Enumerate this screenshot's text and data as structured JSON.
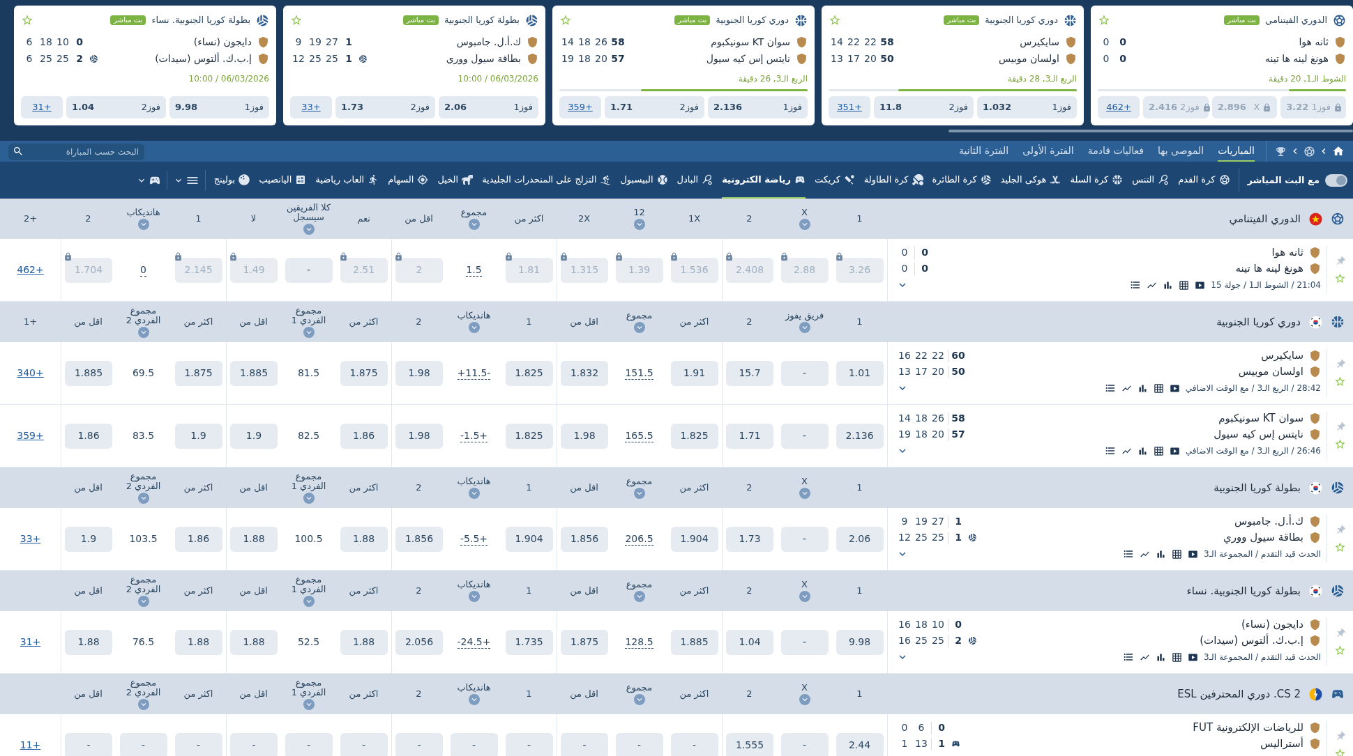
{
  "carousel": {
    "cards": [
      {
        "league": "الدوري الفيتنامي",
        "kind": "football",
        "live": "بث مباشر",
        "teams": [
          {
            "name": "ثانه هوا",
            "score": "0",
            "sets": [
              "0"
            ],
            "serving": false
          },
          {
            "name": "هونغ لينه ها تينه",
            "score": "0",
            "sets": [
              "0"
            ],
            "serving": false
          }
        ],
        "status": "الشوط الـ1, 20 دقيقة",
        "progress": {
          "level": 0.23
        },
        "odds": [
          {
            "label": "فوز1",
            "value": "3.22",
            "locked": true
          },
          {
            "label": "X",
            "value": "2.896",
            "locked": true
          },
          {
            "label": "فوز2",
            "value": "2.416",
            "locked": true
          }
        ],
        "more": "462+"
      },
      {
        "league": "دوري كوريا الجنوبية",
        "kind": "basketball",
        "live": "بث مباشر",
        "teams": [
          {
            "name": "سايكيرس",
            "score": "58",
            "sets": [
              "22",
              "22",
              "14"
            ],
            "serving": false
          },
          {
            "name": "اولسان موبيس",
            "score": "50",
            "sets": [
              "20",
              "17",
              "13"
            ],
            "serving": false
          }
        ],
        "status": "الربع الـ3, 28 دقيقة",
        "progress": {
          "level": 0.72
        },
        "odds": [
          {
            "label": "فوز1",
            "value": "1.032",
            "locked": false
          },
          {
            "label": "فوز2",
            "value": "11.8",
            "locked": false
          }
        ],
        "more": "351+"
      },
      {
        "league": "دوري كوريا الجنوبية",
        "kind": "basketball",
        "live": "بث مباشر",
        "teams": [
          {
            "name": "سوان KT سونيكبوم",
            "score": "58",
            "sets": [
              "26",
              "18",
              "14"
            ],
            "serving": false
          },
          {
            "name": "نايتس إس كيه سيول",
            "score": "57",
            "sets": [
              "20",
              "18",
              "19"
            ],
            "serving": false
          }
        ],
        "status": "الربع الـ3, 26 دقيقة",
        "progress": {
          "level": 0.67
        },
        "odds": [
          {
            "label": "فوز1",
            "value": "2.136",
            "locked": false
          },
          {
            "label": "فوز2",
            "value": "1.71",
            "locked": false
          }
        ],
        "more": "359+"
      },
      {
        "league": "بطولة كوريا الجنوبية",
        "kind": "volleyball",
        "live": "بث مباشر",
        "teams": [
          {
            "name": "ك.أ.ل. جامبوس",
            "score": "1",
            "sets": [
              "27",
              "19",
              "9"
            ],
            "serving": false
          },
          {
            "name": "بطاقة سيول ووري",
            "score": "1",
            "sets": [
              "25",
              "25",
              "12"
            ],
            "serving": true
          }
        ],
        "status": "10:00 / 06/03/2026",
        "odds": [
          {
            "label": "فوز1",
            "value": "2.06",
            "locked": false
          },
          {
            "label": "فوز2",
            "value": "1.73",
            "locked": false
          }
        ],
        "more": "33+"
      },
      {
        "league": "بطولة كوريا الجنوبية. نساء",
        "kind": "volleyball",
        "live": "بث مباشر",
        "teams": [
          {
            "name": "دايجون (نساء)",
            "score": "0",
            "sets": [
              "10",
              "18",
              "6"
            ],
            "serving": false
          },
          {
            "name": "إ.ب.ك. ألتوس (سيدات)",
            "score": "2",
            "sets": [
              "25",
              "25",
              "6"
            ],
            "serving": true
          }
        ],
        "status": "10:00 / 06/03/2026",
        "odds": [
          {
            "label": "فوز1",
            "value": "9.98",
            "locked": false
          },
          {
            "label": "فوز2",
            "value": "1.04",
            "locked": false
          }
        ],
        "more": "31+"
      }
    ]
  },
  "nav": {
    "tabs": [
      {
        "label": "المباريات",
        "selected": true
      },
      {
        "label": "الموصى بها",
        "selected": false
      },
      {
        "label": "فعاليات قادمة",
        "selected": false
      },
      {
        "label": "الفترة الأولى",
        "selected": false
      },
      {
        "label": "الفترة الثانية",
        "selected": false
      }
    ],
    "search": {
      "placeholder": "البحث حسب المباراة"
    }
  },
  "sports_bar": {
    "live_toggle": {
      "label": "مع البث المباشر",
      "on": true
    },
    "sports": [
      {
        "label": "كرة القدم",
        "kind": "football",
        "selected": false
      },
      {
        "label": "التنس",
        "kind": "tennis",
        "selected": false
      },
      {
        "label": "كرة السلة",
        "kind": "basketball",
        "selected": false
      },
      {
        "label": "هوكى الجليد",
        "kind": "hockey",
        "selected": false
      },
      {
        "label": "كرة الطائرة",
        "kind": "volleyball",
        "selected": false
      },
      {
        "label": "كرة الطاولة",
        "kind": "table_tennis",
        "selected": false
      },
      {
        "label": "كريكت",
        "kind": "cricket",
        "selected": false
      },
      {
        "label": "رياضة الكترونية",
        "kind": "esports",
        "selected": true
      },
      {
        "label": "البادل",
        "kind": "padel",
        "selected": false
      },
      {
        "label": "البيسبول",
        "kind": "baseball",
        "selected": false
      },
      {
        "label": "التزلج على المنحدرات الجليدية",
        "kind": "skiing",
        "selected": false
      },
      {
        "label": "الخيل",
        "kind": "horse_racing",
        "selected": false
      },
      {
        "label": "السهام",
        "kind": "darts",
        "selected": false
      },
      {
        "label": "العاب رياضية",
        "kind": "athletics",
        "selected": false
      },
      {
        "label": "اليانصيب",
        "kind": "lottery",
        "selected": false
      },
      {
        "label": "بولينج",
        "kind": "bowling",
        "selected": false
      }
    ]
  },
  "table": {
    "groups": [
      {
        "league": "الدوري الفيتنامي",
        "kind": "football",
        "flag": {
          "kind": "vn"
        },
        "more_label": "2+",
        "columns": [
          {
            "label": "1",
            "dropdown": false
          },
          {
            "label": "X",
            "dropdown": true
          },
          {
            "label": "2",
            "dropdown": false
          },
          {
            "label": "1X",
            "dropdown": false
          },
          {
            "label": "12",
            "dropdown": true
          },
          {
            "label": "2X",
            "dropdown": false
          },
          {
            "label": "اكثر من",
            "dropdown": false
          },
          {
            "label": "مجموع",
            "dropdown": true
          },
          {
            "label": "اقل من",
            "dropdown": false
          },
          {
            "label": "نعم",
            "dropdown": false
          },
          {
            "label": "كلا الفريقين سيسجل",
            "dropdown": true
          },
          {
            "label": "لا",
            "dropdown": false
          },
          {
            "label": "1",
            "dropdown": false
          },
          {
            "label": "هانديكاب",
            "dropdown": true
          },
          {
            "label": "2",
            "dropdown": false
          }
        ],
        "matches": [
          {
            "teams": [
              {
                "name": "ثانه هوا",
                "score": "0",
                "sets": [
                  "0"
                ],
                "serving": false
              },
              {
                "name": "هونغ لينه ها تينه",
                "score": "0",
                "sets": [
                  "0"
                ],
                "serving": false
              }
            ],
            "meta": "21:04 / الشوط الـ1 / جولة 15",
            "more": "462+",
            "cells": [
              {
                "v": "3.26",
                "kind": "locked"
              },
              {
                "v": "2.88",
                "kind": "locked"
              },
              {
                "v": "2.408",
                "kind": "locked"
              },
              {
                "v": "1.536",
                "kind": "locked"
              },
              {
                "v": "1.39",
                "kind": "locked"
              },
              {
                "v": "1.315",
                "kind": "locked"
              },
              {
                "v": "1.81",
                "kind": "locked"
              },
              {
                "v": "1.5",
                "kind": "line"
              },
              {
                "v": "2",
                "kind": "locked"
              },
              {
                "v": "2.51",
                "kind": "locked"
              },
              {
                "v": "-",
                "kind": "odd"
              },
              {
                "v": "1.49",
                "kind": "locked"
              },
              {
                "v": "2.145",
                "kind": "locked"
              },
              {
                "v": "0",
                "kind": "line"
              },
              {
                "v": "1.704",
                "kind": "locked"
              }
            ]
          }
        ]
      },
      {
        "league": "دوري كوريا الجنوبية",
        "kind": "basketball",
        "flag": {
          "kind": "kr"
        },
        "more_label": "1+",
        "columns": [
          {
            "label": "1",
            "dropdown": false
          },
          {
            "label": "فريق يفوز",
            "dropdown": true
          },
          {
            "label": "2",
            "dropdown": false
          },
          {
            "label": "اكثر من",
            "dropdown": false
          },
          {
            "label": "مجموع",
            "dropdown": true
          },
          {
            "label": "اقل من",
            "dropdown": false
          },
          {
            "label": "1",
            "dropdown": false
          },
          {
            "label": "هانديكاب",
            "dropdown": true
          },
          {
            "label": "2",
            "dropdown": false
          },
          {
            "label": "اكثر من",
            "dropdown": false
          },
          {
            "label": "مجموع الفردي 1",
            "dropdown": true
          },
          {
            "label": "اقل من",
            "dropdown": false
          },
          {
            "label": "اكثر من",
            "dropdown": false
          },
          {
            "label": "مجموع الفردي 2",
            "dropdown": true
          },
          {
            "label": "اقل من",
            "dropdown": false
          }
        ],
        "matches": [
          {
            "teams": [
              {
                "name": "سايكيرس",
                "score": "60",
                "sets": [
                  "22",
                  "22",
                  "16"
                ],
                "serving": false
              },
              {
                "name": "اولسان موبيس",
                "score": "50",
                "sets": [
                  "20",
                  "17",
                  "13"
                ],
                "serving": false
              }
            ],
            "meta": "28:42 / الربع الـ3 / مع الوقت الاضافي",
            "more": "340+",
            "cells": [
              {
                "v": "1.01",
                "kind": "odd"
              },
              {
                "v": "-",
                "kind": "odd"
              },
              {
                "v": "15.7",
                "kind": "odd"
              },
              {
                "v": "1.91",
                "kind": "odd"
              },
              {
                "v": "151.5",
                "kind": "line"
              },
              {
                "v": "1.832",
                "kind": "odd"
              },
              {
                "v": "1.825",
                "kind": "odd"
              },
              {
                "v": "+11.5-",
                "kind": "line"
              },
              {
                "v": "1.98",
                "kind": "odd"
              },
              {
                "v": "1.875",
                "kind": "odd"
              },
              {
                "v": "81.5",
                "kind": "plain"
              },
              {
                "v": "1.885",
                "kind": "odd"
              },
              {
                "v": "1.875",
                "kind": "odd"
              },
              {
                "v": "69.5",
                "kind": "plain"
              },
              {
                "v": "1.885",
                "kind": "odd"
              }
            ]
          },
          {
            "teams": [
              {
                "name": "سوان KT سونيكبوم",
                "score": "58",
                "sets": [
                  "26",
                  "18",
                  "14"
                ],
                "serving": false
              },
              {
                "name": "نايتس إس كيه سيول",
                "score": "57",
                "sets": [
                  "20",
                  "18",
                  "19"
                ],
                "serving": false
              }
            ],
            "meta": "26:46 / الربع الـ3 / مع الوقت الاضافي",
            "more": "359+",
            "cells": [
              {
                "v": "2.136",
                "kind": "odd"
              },
              {
                "v": "-",
                "kind": "odd"
              },
              {
                "v": "1.71",
                "kind": "odd"
              },
              {
                "v": "1.825",
                "kind": "odd"
              },
              {
                "v": "165.5",
                "kind": "line"
              },
              {
                "v": "1.98",
                "kind": "odd"
              },
              {
                "v": "1.825",
                "kind": "odd"
              },
              {
                "v": "-1.5+",
                "kind": "line"
              },
              {
                "v": "1.98",
                "kind": "odd"
              },
              {
                "v": "1.86",
                "kind": "odd"
              },
              {
                "v": "82.5",
                "kind": "plain"
              },
              {
                "v": "1.9",
                "kind": "odd"
              },
              {
                "v": "1.9",
                "kind": "odd"
              },
              {
                "v": "83.5",
                "kind": "plain"
              },
              {
                "v": "1.86",
                "kind": "odd"
              }
            ]
          }
        ]
      },
      {
        "league": "بطولة كوريا الجنوبية",
        "kind": "volleyball",
        "flag": {
          "kind": "kr"
        },
        "columns": [
          {
            "label": "1",
            "dropdown": false
          },
          {
            "label": "X",
            "dropdown": true
          },
          {
            "label": "2",
            "dropdown": false
          },
          {
            "label": "اكثر من",
            "dropdown": false
          },
          {
            "label": "مجموع",
            "dropdown": true
          },
          {
            "label": "اقل من",
            "dropdown": false
          },
          {
            "label": "1",
            "dropdown": false
          },
          {
            "label": "هانديكاب",
            "dropdown": true
          },
          {
            "label": "2",
            "dropdown": false
          },
          {
            "label": "اكثر من",
            "dropdown": false
          },
          {
            "label": "مجموع الفردي 1",
            "dropdown": true
          },
          {
            "label": "اقل من",
            "dropdown": false
          },
          {
            "label": "اكثر من",
            "dropdown": false
          },
          {
            "label": "مجموع الفردي 2",
            "dropdown": true
          },
          {
            "label": "اقل من",
            "dropdown": false
          }
        ],
        "matches": [
          {
            "teams": [
              {
                "name": "ك.أ.ل. جامبوس",
                "score": "1",
                "sets": [
                  "27",
                  "19",
                  "9"
                ],
                "serving": false
              },
              {
                "name": "بطاقة سيول ووري",
                "score": "1",
                "sets": [
                  "25",
                  "25",
                  "12"
                ],
                "serving": true
              }
            ],
            "meta": "الحدث قيد التقدم / المجموعة الـ3",
            "more": "33+",
            "cells": [
              {
                "v": "2.06",
                "kind": "odd"
              },
              {
                "v": "-",
                "kind": "odd"
              },
              {
                "v": "1.73",
                "kind": "odd"
              },
              {
                "v": "1.904",
                "kind": "odd"
              },
              {
                "v": "206.5",
                "kind": "line"
              },
              {
                "v": "1.856",
                "kind": "odd"
              },
              {
                "v": "1.904",
                "kind": "odd"
              },
              {
                "v": "-5.5+",
                "kind": "line"
              },
              {
                "v": "1.856",
                "kind": "odd"
              },
              {
                "v": "1.88",
                "kind": "odd"
              },
              {
                "v": "100.5",
                "kind": "plain"
              },
              {
                "v": "1.88",
                "kind": "odd"
              },
              {
                "v": "1.86",
                "kind": "odd"
              },
              {
                "v": "103.5",
                "kind": "plain"
              },
              {
                "v": "1.9",
                "kind": "odd"
              }
            ]
          }
        ]
      },
      {
        "league": "بطولة كوريا الجنوبية. نساء",
        "kind": "volleyball",
        "flag": {
          "kind": "kr"
        },
        "columns": [
          {
            "label": "1",
            "dropdown": false
          },
          {
            "label": "X",
            "dropdown": true
          },
          {
            "label": "2",
            "dropdown": false
          },
          {
            "label": "اكثر من",
            "dropdown": false
          },
          {
            "label": "مجموع",
            "dropdown": true
          },
          {
            "label": "اقل من",
            "dropdown": false
          },
          {
            "label": "1",
            "dropdown": false
          },
          {
            "label": "هانديكاب",
            "dropdown": true
          },
          {
            "label": "2",
            "dropdown": false
          },
          {
            "label": "اكثر من",
            "dropdown": false
          },
          {
            "label": "مجموع الفردي 1",
            "dropdown": true
          },
          {
            "label": "اقل من",
            "dropdown": false
          },
          {
            "label": "اكثر من",
            "dropdown": false
          },
          {
            "label": "مجموع الفردي 2",
            "dropdown": true
          },
          {
            "label": "اقل من",
            "dropdown": false
          }
        ],
        "matches": [
          {
            "teams": [
              {
                "name": "دايجون (نساء)",
                "score": "0",
                "sets": [
                  "10",
                  "18",
                  "16"
                ],
                "serving": false
              },
              {
                "name": "إ.ب.ك. ألتوس (سيدات)",
                "score": "2",
                "sets": [
                  "25",
                  "25",
                  "16"
                ],
                "serving": true
              }
            ],
            "meta": "الحدث قيد التقدم / المجموعة الـ3",
            "more": "31+",
            "cells": [
              {
                "v": "9.98",
                "kind": "odd"
              },
              {
                "v": "-",
                "kind": "odd"
              },
              {
                "v": "1.04",
                "kind": "odd"
              },
              {
                "v": "1.885",
                "kind": "odd"
              },
              {
                "v": "128.5",
                "kind": "line"
              },
              {
                "v": "1.875",
                "kind": "odd"
              },
              {
                "v": "1.735",
                "kind": "odd"
              },
              {
                "v": "-24.5+",
                "kind": "line"
              },
              {
                "v": "2.056",
                "kind": "odd"
              },
              {
                "v": "1.88",
                "kind": "odd"
              },
              {
                "v": "52.5",
                "kind": "plain"
              },
              {
                "v": "1.88",
                "kind": "odd"
              },
              {
                "v": "1.88",
                "kind": "odd"
              },
              {
                "v": "76.5",
                "kind": "plain"
              },
              {
                "v": "1.88",
                "kind": "odd"
              }
            ]
          }
        ]
      },
      {
        "league": "CS 2. دوري المحترفين ESL",
        "kind": "esports",
        "flag": {
          "kind": "esl"
        },
        "columns": [
          {
            "label": "1",
            "dropdown": false
          },
          {
            "label": "X",
            "dropdown": true
          },
          {
            "label": "2",
            "dropdown": false
          },
          {
            "label": "اكثر من",
            "dropdown": false
          },
          {
            "label": "مجموع",
            "dropdown": true
          },
          {
            "label": "اقل من",
            "dropdown": false
          },
          {
            "label": "1",
            "dropdown": false
          },
          {
            "label": "هانديكاب",
            "dropdown": true
          },
          {
            "label": "2",
            "dropdown": false
          },
          {
            "label": "اكثر من",
            "dropdown": false
          },
          {
            "label": "مجموع الفردي 1",
            "dropdown": true
          },
          {
            "label": "اقل من",
            "dropdown": false
          },
          {
            "label": "اكثر من",
            "dropdown": false
          },
          {
            "label": "مجموع الفردي 2",
            "dropdown": true
          },
          {
            "label": "اقل من",
            "dropdown": false
          }
        ],
        "matches": [
          {
            "teams": [
              {
                "name": "للرياضات الإلكترونية FUT",
                "score": "0",
                "sets": [
                  "6",
                  "0"
                ],
                "serving": false
              },
              {
                "name": "أستراليس",
                "score": "1",
                "sets": [
                  "13",
                  "1"
                ],
                "serving": true
              }
            ],
            "more": "11+",
            "cells": [
              {
                "v": "2.44",
                "kind": "odd"
              },
              {
                "v": "-",
                "kind": "odd"
              },
              {
                "v": "1.555",
                "kind": "odd"
              },
              {
                "v": "-",
                "kind": "odd"
              },
              {
                "v": "-",
                "kind": "odd"
              },
              {
                "v": "-",
                "kind": "odd"
              },
              {
                "v": "-",
                "kind": "odd"
              },
              {
                "v": "-",
                "kind": "odd"
              },
              {
                "v": "-",
                "kind": "odd"
              },
              {
                "v": "-",
                "kind": "odd"
              },
              {
                "v": "-",
                "kind": "odd"
              },
              {
                "v": "-",
                "kind": "odd"
              },
              {
                "v": "-",
                "kind": "odd"
              },
              {
                "v": "-",
                "kind": "odd"
              },
              {
                "v": "-",
                "kind": "odd"
              }
            ]
          }
        ]
      }
    ]
  }
}
